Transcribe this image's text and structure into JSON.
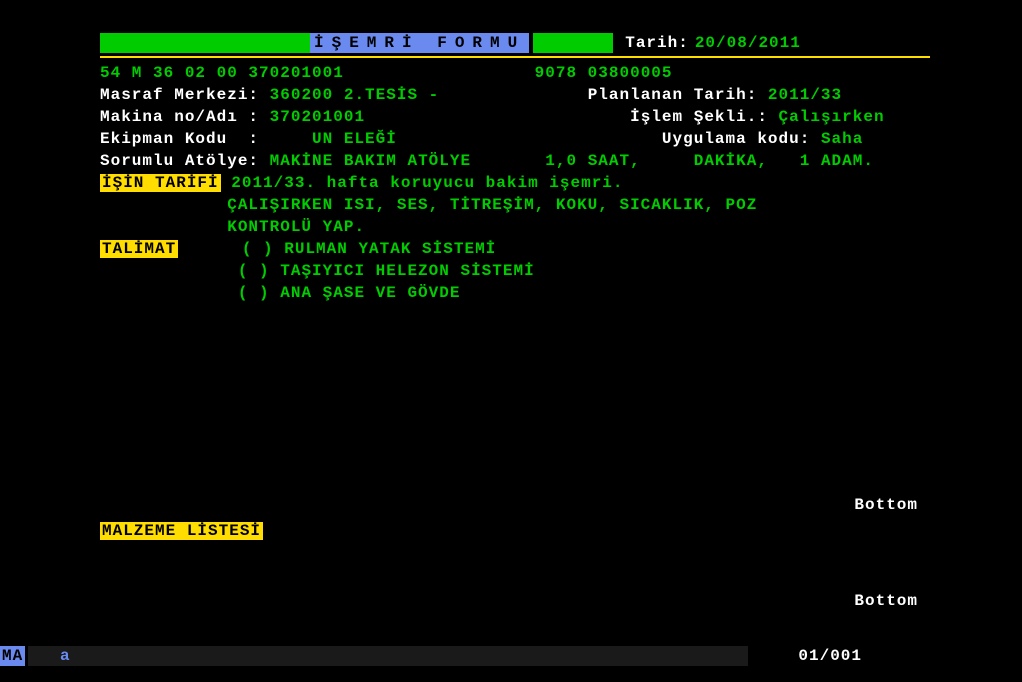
{
  "header": {
    "title": "İŞEMRİ FORMU",
    "date_label": "Tarih:",
    "date_value": "20/08/2011"
  },
  "line1": {
    "code_left": "54 M 36 02 00 370201001",
    "code_right": "9078 03800005"
  },
  "masraf": {
    "label": "Masraf Merkezi:",
    "value": "360200 2.TESİS -",
    "plan_label": "Planlanan Tarih:",
    "plan_value": "2011/33"
  },
  "makina": {
    "label": "Makina no/Adı :",
    "value": "370201001",
    "islem_label": "İşlem Şekli.:",
    "islem_value": "Çalışırken"
  },
  "ekipman": {
    "label": "Ekipman Kodu  :",
    "value": "UN ELEĞİ",
    "uyg_label": "Uygulama kodu:",
    "uyg_value": "Saha"
  },
  "sorumlu": {
    "label": "Sorumlu Atölye:",
    "value": "MAKİNE BAKIM ATÖLYE",
    "time": "1,0 SAAT,     DAKİKA,   1 ADAM."
  },
  "isin_tarifi": {
    "label": "İŞİN TARİFİ",
    "line1": "2011/33. hafta koruyucu bakim işemri.",
    "line2": "ÇALIŞIRKEN ISI, SES, TİTREŞİM, KOKU, SICAKLIK, POZ",
    "line3": "KONTROLÜ YAP."
  },
  "talimat": {
    "label": "TALİMAT",
    "items": [
      "( ) RULMAN YATAK SİSTEMİ",
      "( ) TAŞIYICI HELEZON SİSTEMİ",
      "( ) ANA ŞASE VE GÖVDE"
    ]
  },
  "bottom_text": "Bottom",
  "malzeme_label": "MALZEME LİSTESİ",
  "status": {
    "ma": "MA",
    "a": "a",
    "page": "01/001"
  }
}
